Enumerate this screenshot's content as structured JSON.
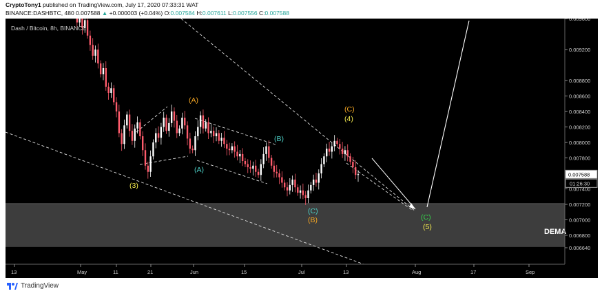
{
  "header": {
    "publisher": "CryptoTony1",
    "published_text": "published on TradingView.com, July 17, 2020 07:33:31 WAT",
    "symbol_line": "BINANCE:DASHBTC, 480",
    "last": "0.007588",
    "change": "+0.000003 (+0.04%)",
    "open_label": "O:",
    "open": "0.007584",
    "high_label": "H:",
    "high": "0.007611",
    "low_label": "L:",
    "low": "0.007556",
    "close_label": "C:",
    "close": "0.007588"
  },
  "footer": {
    "brand": "TradingView"
  },
  "chart_data": {
    "type": "candlestick",
    "title": "Dash / Bitcoin, 8h, BINANCE",
    "x_tick_labels": [
      "13",
      "May",
      "11",
      "21",
      "Jun",
      "15",
      "Jul",
      "13",
      "Aug",
      "17",
      "Sep"
    ],
    "y_tick_labels": [
      "0.009600",
      "0.009200",
      "0.008800",
      "0.008600",
      "0.008400",
      "0.008200",
      "0.008000",
      "0.007800",
      "0.007400",
      "0.007200",
      "0.007000",
      "0.006800",
      "0.006640"
    ],
    "y_ticks": [
      0.0096,
      0.0092,
      0.0088,
      0.0086,
      0.0084,
      0.0082,
      0.008,
      0.0078,
      0.0074,
      0.0072,
      0.007,
      0.0068,
      0.00664
    ],
    "last_price_label": "0.007588",
    "countdown_label": "01:26:30",
    "demand_zone": {
      "label": "DEMA",
      "low": 0.00665,
      "high": 0.00721
    },
    "wave_labels": [
      {
        "text": "(3)",
        "color": "#f2e94e"
      },
      {
        "text": "(A)",
        "color": "#f5a623"
      },
      {
        "text": "(A)",
        "color": "#4dd0c7"
      },
      {
        "text": "(B)",
        "color": "#4dd0c7"
      },
      {
        "text": "(C)",
        "color": "#f5a623"
      },
      {
        "text": "(4)",
        "color": "#f2e94e"
      },
      {
        "text": "(C)",
        "color": "#4dd0c7"
      },
      {
        "text": "(B)",
        "color": "#f5a623"
      },
      {
        "text": "(C)",
        "color": "#35d24a"
      },
      {
        "text": "(5)",
        "color": "#f2e94e"
      }
    ],
    "price_path": [
      [
        0.00975,
        0.00955,
        0.00962,
        0.00948,
        0.00958,
        0.00938,
        0.00926,
        0.00912,
        0.0092,
        0.00902,
        0.00888,
        0.00896,
        0.00872,
        0.00864,
        0.0087,
        0.00852,
        0.0084,
        0.00812,
        0.00798,
        0.00822,
        0.00836,
        0.00815,
        0.00802,
        0.00818,
        0.00826,
        0.00808,
        0.0079,
        0.0077,
        0.00762,
        0.00782,
        0.008,
        0.00812,
        0.00806,
        0.0082,
        0.00832,
        0.00815,
        0.00825,
        0.0084,
        0.00828,
        0.00812,
        0.00818,
        0.00832,
        0.00822,
        0.00805,
        0.00792,
        0.0079,
        0.00808,
        0.0082,
        0.00835,
        0.00818,
        0.00826,
        0.00812,
        0.00815,
        0.00808,
        0.00812,
        0.00802,
        0.00806,
        0.00798,
        0.00792,
        0.0079,
        0.00795,
        0.00788,
        0.00782,
        0.00785,
        0.00776,
        0.00772,
        0.00768,
        0.00766,
        0.0077,
        0.00762,
        0.00758,
        0.00772,
        0.00785,
        0.00795,
        0.0078,
        0.0077,
        0.00762,
        0.0076,
        0.00755,
        0.00748,
        0.00742,
        0.00738,
        0.00745,
        0.00752,
        0.00742,
        0.00735,
        0.00738,
        0.00732,
        0.00728,
        0.00738,
        0.00745,
        0.00752,
        0.00748,
        0.0076,
        0.00772,
        0.00782,
        0.00792,
        0.00788,
        0.00795,
        0.00802,
        0.00798,
        0.00792,
        0.00785,
        0.0079,
        0.00782,
        0.00775,
        0.00768,
        0.00758,
        0.00759
      ]
    ]
  }
}
